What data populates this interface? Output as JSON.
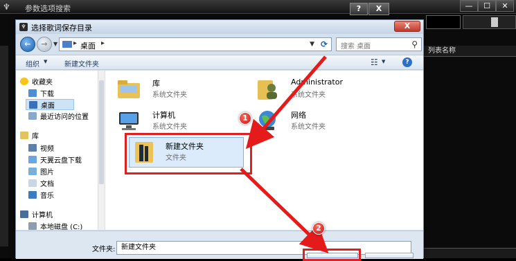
{
  "app": {
    "title": "参数选项搜索",
    "col_header": "列表名称",
    "help_label": "?",
    "close_label": "X",
    "min_label": "—",
    "max_label": "☐",
    "x_label": "✕"
  },
  "dialog": {
    "title": "选择歌词保存目录",
    "close_label": "X",
    "address": {
      "crumb": "桌面",
      "search_placeholder": "搜索 桌面"
    },
    "toolbar": {
      "organize": "组织",
      "new_folder": "新建文件夹",
      "help": "?"
    },
    "nav": {
      "favorites_head": "收藏夹",
      "favorites": [
        "下载",
        "桌面",
        "最近访问的位置"
      ],
      "libraries_head": "库",
      "libraries": [
        "视频",
        "天翼云盘下载",
        "图片",
        "文档",
        "音乐"
      ],
      "computer_head": "计算机",
      "computer_items": [
        "本地磁盘 (C:)"
      ]
    },
    "items": [
      {
        "name": "库",
        "sub": "系统文件夹"
      },
      {
        "name": "Administrator",
        "sub": "系统文件夹"
      },
      {
        "name": "计算机",
        "sub": "系统文件夹"
      },
      {
        "name": "网络",
        "sub": "系统文件夹"
      },
      {
        "name": "新建文件夹",
        "sub": "文件夹"
      }
    ],
    "bottom": {
      "folder_label": "文件夹:",
      "folder_value": "新建文件夹"
    }
  },
  "annotations": {
    "badge1": "1",
    "badge2": "2"
  },
  "colors": {
    "highlight_red": "#e02020",
    "selection_blue": "#dcebfb"
  }
}
